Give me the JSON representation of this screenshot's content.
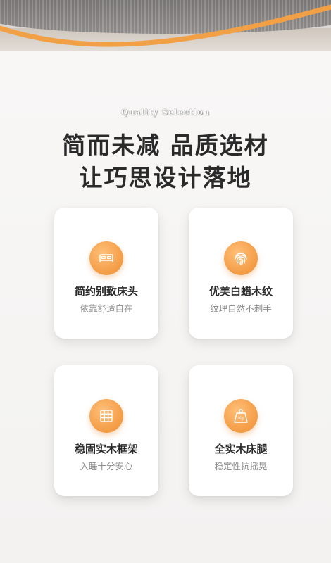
{
  "header": {
    "subtitle": "Quality Selection",
    "title_line1": "简而未减 品质选材",
    "title_line2": "让巧思设计落地"
  },
  "colors": {
    "accent": "#f5a04b",
    "title": "#2a2a2a",
    "subtext": "#8a8a8a"
  },
  "features": [
    {
      "icon": "bed-icon",
      "title": "简约别致床头",
      "subtitle": "依靠舒适自在"
    },
    {
      "icon": "fingerprint-icon",
      "title": "优美白蜡木纹",
      "subtitle": "纹理自然不刺手"
    },
    {
      "icon": "grid-frame-icon",
      "title": "稳固实木框架",
      "subtitle": "入睡十分安心"
    },
    {
      "icon": "weight-kg-icon",
      "title": "全实木床腿",
      "subtitle": "稳定性抗摇晃",
      "icon_text": "Kg"
    }
  ]
}
